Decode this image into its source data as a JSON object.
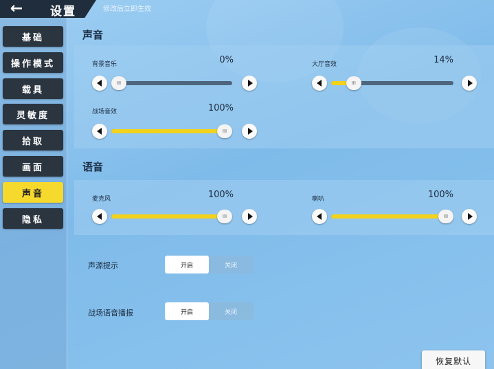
{
  "header": {
    "back_icon": "back-arrow-icon",
    "title": "设置",
    "subtitle": "修改后立即生效"
  },
  "sidebar": {
    "items": [
      {
        "label": "基础",
        "active": false
      },
      {
        "label": "操作模式",
        "active": false
      },
      {
        "label": "载具",
        "active": false
      },
      {
        "label": "灵敏度",
        "active": false
      },
      {
        "label": "拾取",
        "active": false
      },
      {
        "label": "画面",
        "active": false
      },
      {
        "label": "声音",
        "active": true
      },
      {
        "label": "隐私",
        "active": false
      }
    ]
  },
  "sound": {
    "title": "声音",
    "bgm": {
      "label": "背景音乐",
      "value": "0%",
      "level": 0
    },
    "lobby": {
      "label": "大厅音效",
      "value": "14%",
      "level": 0.14
    },
    "battle": {
      "label": "战场音效",
      "value": "100%",
      "level": 1.0
    }
  },
  "voice": {
    "title": "语音",
    "mic": {
      "label": "麦克风",
      "value": "100%",
      "level": 1.0
    },
    "speaker": {
      "label": "喇叭",
      "value": "100%",
      "level": 1.0
    }
  },
  "toggles": {
    "sound_source": {
      "label": "声源提示",
      "on_label": "开启",
      "off_label": "关闭",
      "selected": "on"
    },
    "battle_voice": {
      "label": "战场语音播报",
      "on_label": "开启",
      "off_label": "关闭",
      "selected": "on"
    }
  },
  "reset_label": "恢复默认",
  "colors": {
    "accent": "#f6d92d",
    "sidebar_item": "#2b3540",
    "track": "#4e667d"
  }
}
